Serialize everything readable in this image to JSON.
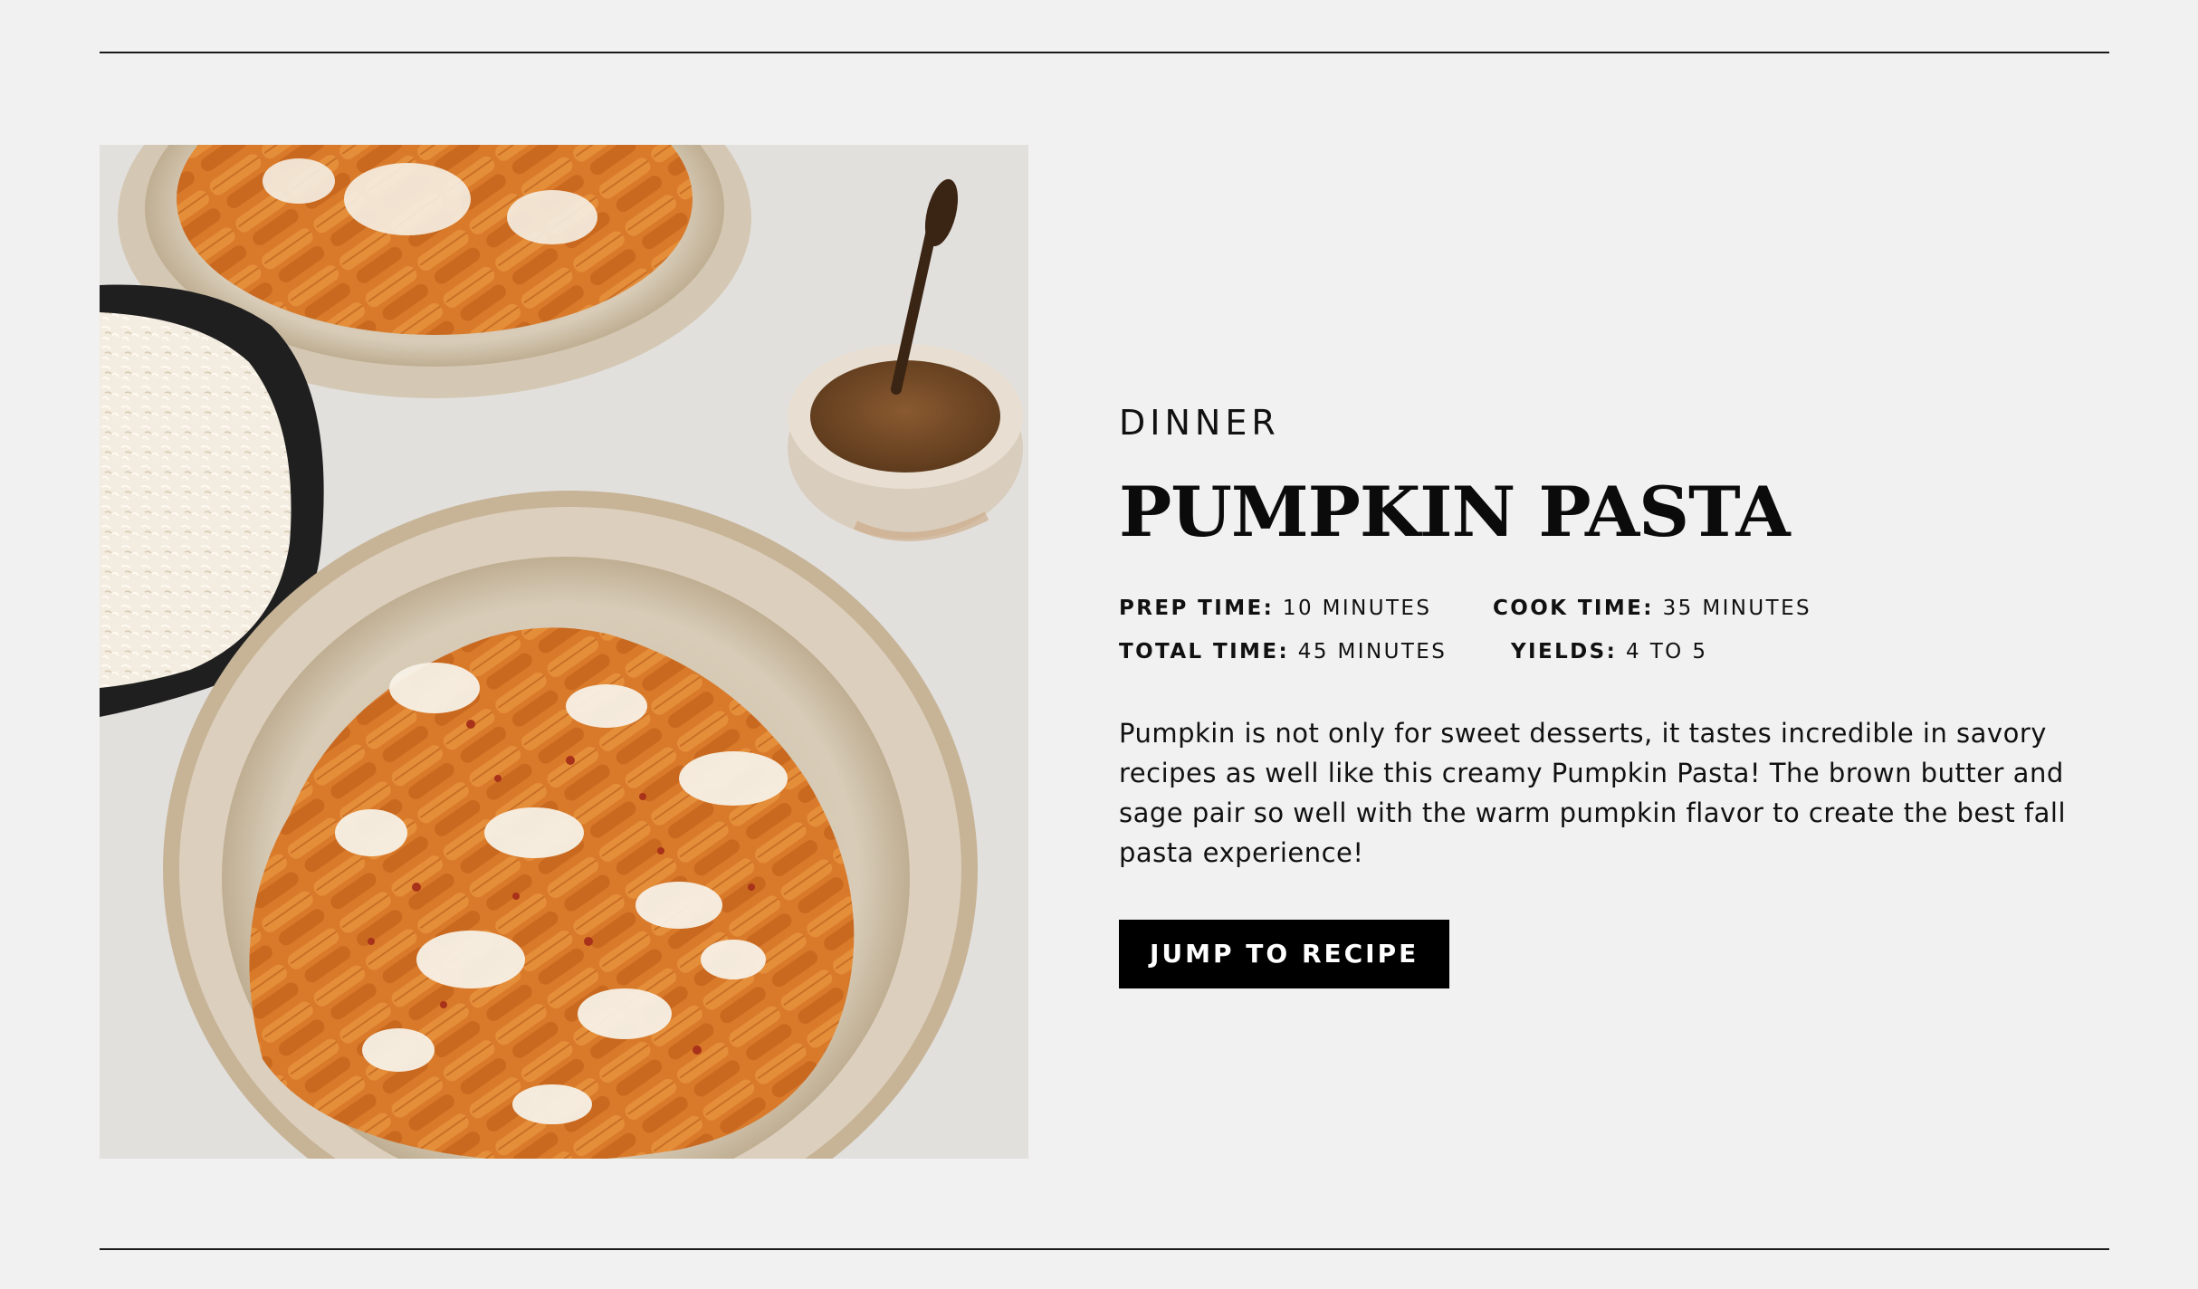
{
  "recipe": {
    "category": "DINNER",
    "title": "PUMPKIN PASTA",
    "meta": {
      "prep_label": "PREP TIME:",
      "prep_value": "10 MINUTES",
      "cook_label": "COOK TIME:",
      "cook_value": "35 MINUTES",
      "total_label": "TOTAL TIME:",
      "total_value": "45 MINUTES",
      "yields_label": "YIELDS:",
      "yields_value": "4 TO 5"
    },
    "description": "Pumpkin is not only for sweet desserts, it tastes incredible in savory recipes as well like this creamy Pumpkin Pasta! The brown butter and sage pair so well with the warm pumpkin flavor to create the best fall pasta experience!",
    "button_label": "JUMP TO RECIPE"
  },
  "colors": {
    "background": "#f1f1f1",
    "text": "#111111",
    "button_bg": "#000000",
    "button_text": "#ffffff",
    "pasta": "#d9782a",
    "bowl": "#cfc3b0"
  }
}
